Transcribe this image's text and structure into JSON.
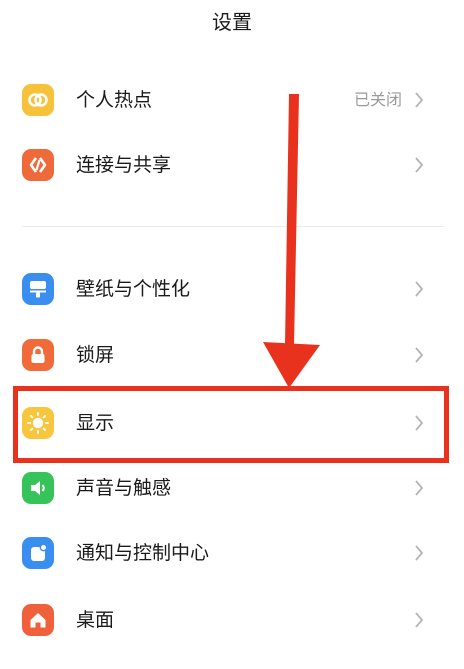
{
  "header": {
    "title": "设置"
  },
  "rows": [
    {
      "label": "个人热点",
      "value": "已关闭",
      "icon": "hotspot-icon",
      "icon_bg": "#f7c13a"
    },
    {
      "label": "连接与共享",
      "value": "",
      "icon": "connection-share-icon",
      "icon_bg": "#ef6a3a"
    },
    {
      "label": "壁纸与个性化",
      "value": "",
      "icon": "wallpaper-icon",
      "icon_bg": "#3a8ef0"
    },
    {
      "label": "锁屏",
      "value": "",
      "icon": "lock-icon",
      "icon_bg": "#f06a3a"
    },
    {
      "label": "显示",
      "value": "",
      "icon": "sun-icon",
      "icon_bg": "#f8c63c"
    },
    {
      "label": "声音与触感",
      "value": "",
      "icon": "speaker-icon",
      "icon_bg": "#35c35a"
    },
    {
      "label": "通知与控制中心",
      "value": "",
      "icon": "notification-icon",
      "icon_bg": "#3a8ef0"
    },
    {
      "label": "桌面",
      "value": "",
      "icon": "home-icon",
      "icon_bg": "#f0603a"
    }
  ],
  "annotation": {
    "color": "#e8321e",
    "highlighted_row": "显示"
  }
}
